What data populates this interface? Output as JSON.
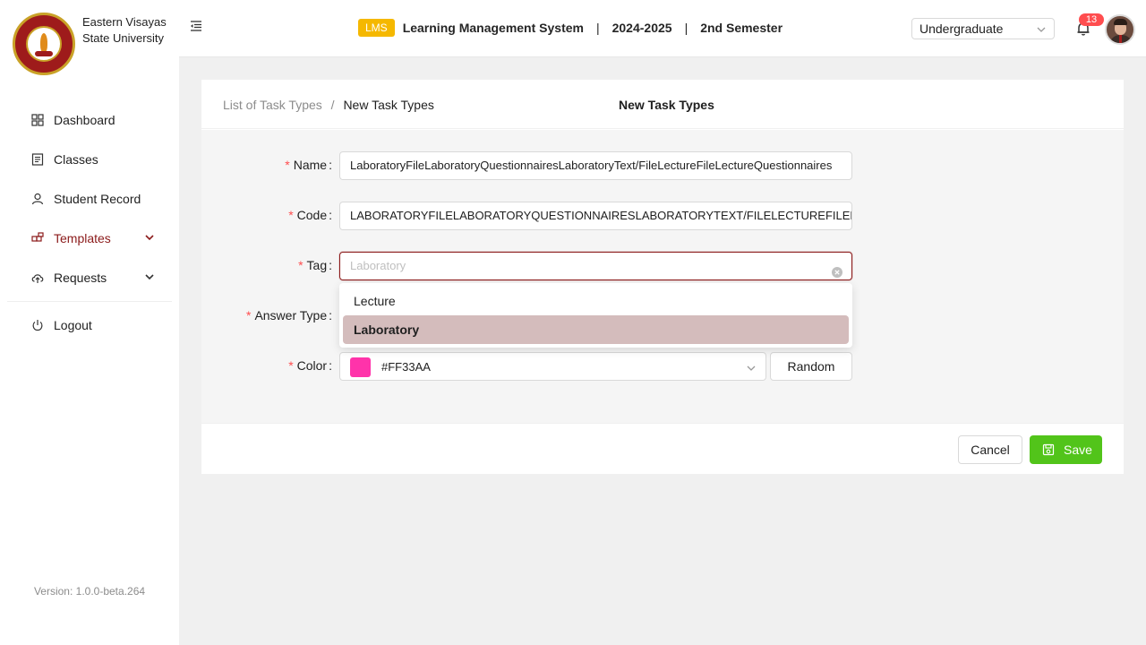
{
  "brand": {
    "line1": "Eastern Visayas",
    "line2": "State University",
    "seal_lettering": "EASTERN VISAYAS STATE UNIVERSITY 1907"
  },
  "sidebar": {
    "items": [
      {
        "label": "Dashboard",
        "icon": "grid-icon"
      },
      {
        "label": "Classes",
        "icon": "list-icon"
      },
      {
        "label": "Student Record",
        "icon": "user-icon"
      },
      {
        "label": "Templates",
        "icon": "templates-icon",
        "active": true,
        "has_submenu": true
      },
      {
        "label": "Requests",
        "icon": "cloud-upload-icon",
        "has_submenu": true
      },
      {
        "label": "Logout",
        "icon": "power-icon"
      }
    ],
    "version": "Version: 1.0.0-beta.264"
  },
  "header": {
    "badge": "LMS",
    "system_name": "Learning Management System",
    "separator": "|",
    "school_year": "2024-2025",
    "semester": "2nd Semester",
    "level_select": "Undergraduate",
    "notification_count": "13"
  },
  "breadcrumb": {
    "parent": "List of Task Types",
    "separator": "/",
    "current": "New Task Types"
  },
  "card_title": "New Task Types",
  "form": {
    "name": {
      "label": "Name",
      "value": "LaboratoryFileLaboratoryQuestionnairesLaboratoryText/FileLectureFileLectureQuestionnaires"
    },
    "code": {
      "label": "Code",
      "value": "LABORATORYFILELABORATORYQUESTIONNAIRESLABORATORYTEXT/FILELECTUREFILELECTUREQUESTIONNAIRES"
    },
    "tag": {
      "label": "Tag",
      "placeholder": "Laboratory",
      "options": [
        "Lecture",
        "Laboratory"
      ],
      "selected": "Laboratory"
    },
    "answer_type": {
      "label": "Answer Type"
    },
    "color": {
      "label": "Color",
      "value": "#FF33AA",
      "random_label": "Random"
    }
  },
  "buttons": {
    "cancel": "Cancel",
    "save": "Save"
  },
  "colors": {
    "accent": "#8b1a1a",
    "save": "#52c41a",
    "lms_badge": "#f5b800",
    "swatch": "#FF33AA"
  }
}
